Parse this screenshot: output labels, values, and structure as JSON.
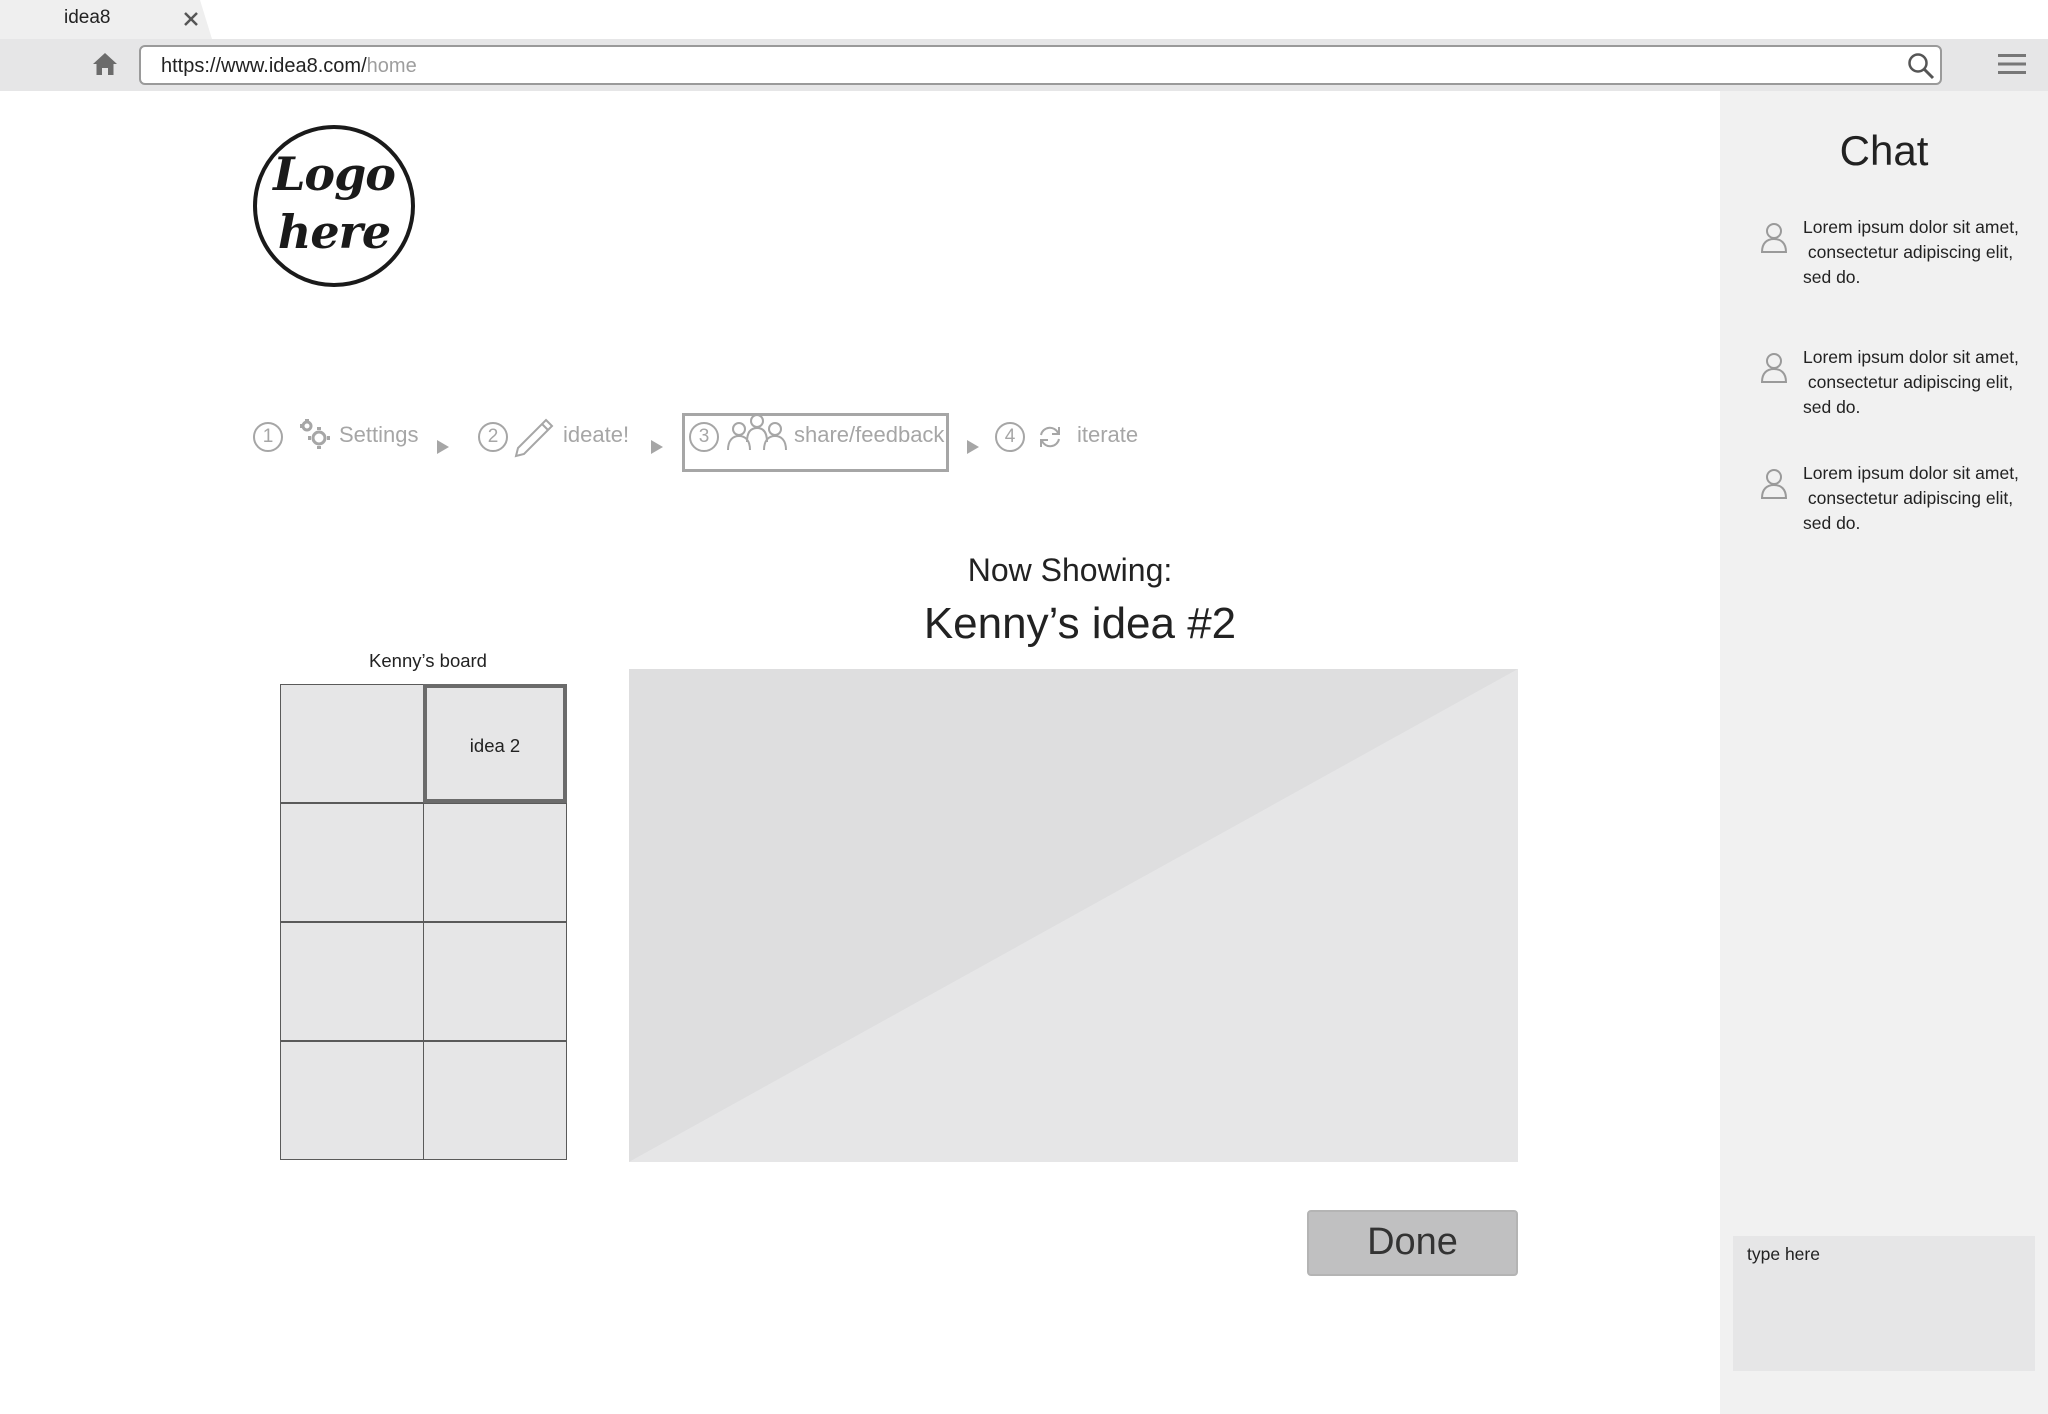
{
  "browser": {
    "tab_title": "idea8",
    "url_host": "https://www.idea8.com/",
    "url_path": "home"
  },
  "logo": {
    "line1": "Logo",
    "line2": "here"
  },
  "steps": [
    {
      "number": "1",
      "label": "Settings",
      "icon": "gear-icon"
    },
    {
      "number": "2",
      "label": "ideate!",
      "icon": "pencil-icon"
    },
    {
      "number": "3",
      "label": "share/feedback",
      "icon": "people-icon",
      "active": true
    },
    {
      "number": "4",
      "label": "iterate",
      "icon": "refresh-icon"
    }
  ],
  "main": {
    "now_showing_label": "Now Showing:",
    "idea_title": "Kenny’s idea #2",
    "board_title": "Kenny’s board",
    "board_cells": [
      "",
      "idea 2",
      "",
      "",
      "",
      "",
      "",
      ""
    ],
    "selected_cell": 1,
    "done_label": "Done"
  },
  "chat": {
    "title": "Chat",
    "messages": [
      {
        "line1": "Lorem ipsum dolor sit amet,",
        "line2": " consectetur adipiscing elit,",
        "line3": "sed do."
      },
      {
        "line1": "Lorem ipsum dolor sit amet,",
        "line2": " consectetur adipiscing elit,",
        "line3": "sed do."
      },
      {
        "line1": "Lorem ipsum dolor sit amet,",
        "line2": " consectetur adipiscing elit,",
        "line3": "sed do."
      }
    ],
    "input_placeholder": "type here"
  },
  "colors": {
    "chrome_bg": "#e6e6e7",
    "panel_bg": "#f1f1f1",
    "muted_text": "#a6a6a6",
    "placeholder_fill": "#e6e6e7",
    "button_fill": "#c0c0c1"
  }
}
